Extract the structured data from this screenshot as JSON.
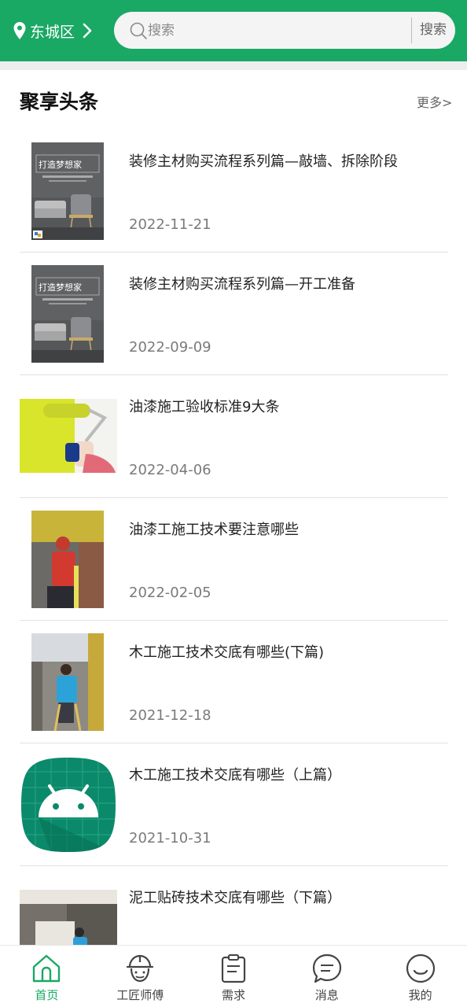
{
  "header": {
    "location": "东城区",
    "search_placeholder": "搜索",
    "search_button": "搜索"
  },
  "section": {
    "title": "聚享头条",
    "more": "更多>"
  },
  "news": [
    {
      "title": "装修主材购买流程系列篇—敲墙、拆除阶段",
      "date": "2022-11-21",
      "thumb": "poster-living-room",
      "poster_text": "打造梦想家"
    },
    {
      "title": "装修主材购买流程系列篇—开工准备",
      "date": "2022-09-09",
      "thumb": "poster-living-room",
      "poster_text": "打造梦想家"
    },
    {
      "title": "油漆施工验收标准9大条",
      "date": "2022-04-06",
      "thumb": "paint-roller-photo"
    },
    {
      "title": "油漆工施工技术要注意哪些",
      "date": "2022-02-05",
      "thumb": "painter-worker-photo"
    },
    {
      "title": "木工施工技术交底有哪些(下篇)",
      "date": "2021-12-18",
      "thumb": "carpenter-worker-photo"
    },
    {
      "title": "木工施工技术交底有哪些（上篇）",
      "date": "2021-10-31",
      "thumb": "android-icon"
    },
    {
      "title": "泥工贴砖技术交底有哪些（下篇）",
      "date": "",
      "thumb": "tiling-photo"
    }
  ],
  "nav": [
    {
      "label": "首页",
      "icon": "home-icon",
      "active": true
    },
    {
      "label": "工匠师傅",
      "icon": "worker-helmet-icon",
      "active": false
    },
    {
      "label": "需求",
      "icon": "clipboard-icon",
      "active": false
    },
    {
      "label": "消息",
      "icon": "message-icon",
      "active": false
    },
    {
      "label": "我的",
      "icon": "smile-icon",
      "active": false
    }
  ],
  "colors": {
    "brand": "#1aa865",
    "inactive_nav": "#444444"
  }
}
